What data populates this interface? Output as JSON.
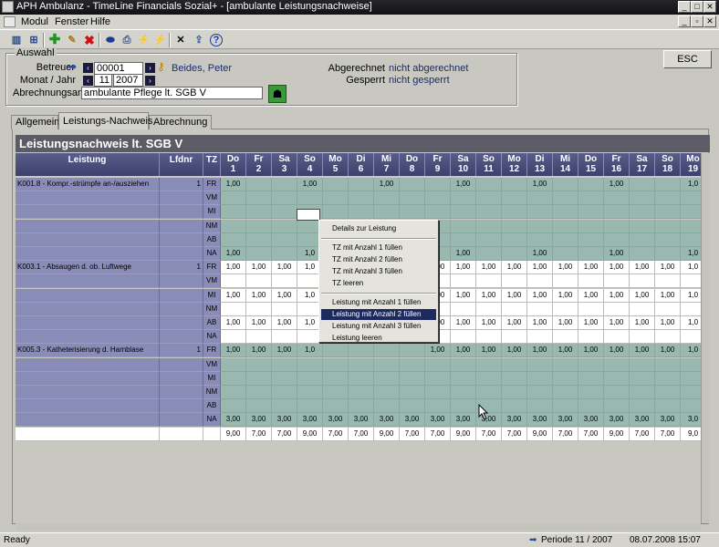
{
  "window": {
    "title": "APH Ambulanz - TimeLine Financials Sozial+ - [ambulante Leistungsnachweise]"
  },
  "menu": [
    "Modul",
    "Fenster",
    "Hilfe"
  ],
  "toolbar": {
    "icons": [
      "layout-icon",
      "tree-icon",
      "add-icon",
      "edit-icon",
      "delete-icon",
      "database-icon",
      "print-icon",
      "lightning-icon",
      "lightning-alt-icon",
      "cancel-icon",
      "export-icon",
      "help-icon"
    ]
  },
  "auswahl": {
    "legend": "Auswahl",
    "betreuer_label": "Betreuer",
    "betreuer_id": "00001",
    "betreuer_name": "Beides, Peter",
    "monat_label": "Monat / Jahr",
    "monat": "11",
    "jahr": "2007",
    "abrechnungsart_label": "Abrechnungsart",
    "abrechnungsart": "ambulante Pflege lt. SGB V",
    "abgerechnet_label": "Abgerechnet",
    "abgerechnet_value": "nicht abgerechnet",
    "gesperrt_label": "Gesperrt",
    "gesperrt_value": "nicht gesperrt"
  },
  "esc_label": "ESC",
  "tabs": [
    "Allgemein",
    "Leistungs-Nachweis",
    "Abrechnung"
  ],
  "panel_title": "Leistungsnachweis lt. SGB V",
  "grid": {
    "col_leistung": "Leistung",
    "col_lfdnr": "Lfdnr",
    "col_tz": "TZ",
    "days": [
      {
        "dow": "Do",
        "d": "1"
      },
      {
        "dow": "Fr",
        "d": "2"
      },
      {
        "dow": "Sa",
        "d": "3"
      },
      {
        "dow": "So",
        "d": "4"
      },
      {
        "dow": "Mo",
        "d": "5"
      },
      {
        "dow": "Di",
        "d": "6"
      },
      {
        "dow": "Mi",
        "d": "7"
      },
      {
        "dow": "Do",
        "d": "8"
      },
      {
        "dow": "Fr",
        "d": "9"
      },
      {
        "dow": "Sa",
        "d": "10"
      },
      {
        "dow": "So",
        "d": "11"
      },
      {
        "dow": "Mo",
        "d": "12"
      },
      {
        "dow": "Di",
        "d": "13"
      },
      {
        "dow": "Mi",
        "d": "14"
      },
      {
        "dow": "Do",
        "d": "15"
      },
      {
        "dow": "Fr",
        "d": "16"
      },
      {
        "dow": "Sa",
        "d": "17"
      },
      {
        "dow": "So",
        "d": "18"
      },
      {
        "dow": "Mo",
        "d": "19"
      }
    ],
    "rows": [
      {
        "leistung": "K001.8 - Kompr.-strümpfe an-/ausziehen",
        "lfdnr": "1",
        "tz": "FR",
        "style": "teal",
        "values": [
          "1,00",
          "",
          "",
          "1,00",
          "",
          "",
          "1,00",
          "",
          "",
          "1,00",
          "",
          "",
          "1,00",
          "",
          "",
          "1,00",
          "",
          "",
          "1,0"
        ]
      },
      {
        "leistung": "",
        "lfdnr": "",
        "tz": "VM",
        "style": "teal",
        "values": [
          "",
          "",
          "",
          "",
          "",
          "",
          "",
          "",
          "",
          "",
          "",
          "",
          "",
          "",
          "",
          "",
          "",
          "",
          ""
        ]
      },
      {
        "leistung": "",
        "lfdnr": "",
        "tz": "MI",
        "style": "teal",
        "values": [
          "",
          "",
          "",
          "",
          "",
          "",
          "",
          "",
          "",
          "",
          "",
          "",
          "",
          "",
          "",
          "",
          "",
          "",
          ""
        ]
      },
      {
        "leistung": "",
        "lfdnr": "",
        "tz": "NM",
        "style": "teal",
        "values": [
          "",
          "",
          "",
          "",
          "",
          "",
          "",
          "",
          "",
          "",
          "",
          "",
          "",
          "",
          "",
          "",
          "",
          "",
          ""
        ]
      },
      {
        "leistung": "",
        "lfdnr": "",
        "tz": "AB",
        "style": "teal",
        "values": [
          "",
          "",
          "",
          "",
          "",
          "",
          "",
          "",
          "",
          "",
          "",
          "",
          "",
          "",
          "",
          "",
          "",
          "",
          ""
        ]
      },
      {
        "leistung": "",
        "lfdnr": "",
        "tz": "NA",
        "style": "teal",
        "values": [
          "1,00",
          "",
          "",
          "1,0",
          "",
          "",
          "",
          "",
          "",
          "1,00",
          "",
          "",
          "1,00",
          "",
          "",
          "1,00",
          "",
          "",
          "1,0"
        ]
      },
      {
        "leistung": "K003.1 - Absaugen d. ob. Luftwege",
        "lfdnr": "1",
        "tz": "FR",
        "style": "white",
        "values": [
          "1,00",
          "1,00",
          "1,00",
          "1,0",
          "",
          "",
          "",
          "",
          "1,00",
          "1,00",
          "1,00",
          "1,00",
          "1,00",
          "1,00",
          "1,00",
          "1,00",
          "1,00",
          "1,00",
          "1,0"
        ]
      },
      {
        "leistung": "",
        "lfdnr": "",
        "tz": "VM",
        "style": "white",
        "values": [
          "",
          "",
          "",
          "",
          "",
          "",
          "",
          "",
          "",
          "",
          "",
          "",
          "",
          "",
          "",
          "",
          "",
          "",
          ""
        ]
      },
      {
        "leistung": "",
        "lfdnr": "",
        "tz": "MI",
        "style": "white",
        "values": [
          "1,00",
          "1,00",
          "1,00",
          "1,0",
          "",
          "",
          "",
          "",
          "1,00",
          "1,00",
          "1,00",
          "1,00",
          "1,00",
          "1,00",
          "1,00",
          "1,00",
          "1,00",
          "1,00",
          "1,0"
        ]
      },
      {
        "leistung": "",
        "lfdnr": "",
        "tz": "NM",
        "style": "white",
        "values": [
          "",
          "",
          "",
          "",
          "",
          "",
          "",
          "",
          "",
          "",
          "",
          "",
          "",
          "",
          "",
          "",
          "",
          "",
          ""
        ]
      },
      {
        "leistung": "",
        "lfdnr": "",
        "tz": "AB",
        "style": "white",
        "values": [
          "1,00",
          "1,00",
          "1,00",
          "1,0",
          "",
          "",
          "",
          "",
          "1,00",
          "1,00",
          "1,00",
          "1,00",
          "1,00",
          "1,00",
          "1,00",
          "1,00",
          "1,00",
          "1,00",
          "1,0"
        ]
      },
      {
        "leistung": "",
        "lfdnr": "",
        "tz": "NA",
        "style": "white",
        "values": [
          "",
          "",
          "",
          "",
          "",
          "",
          "",
          "",
          "",
          "",
          "",
          "",
          "",
          "",
          "",
          "",
          "",
          "",
          ""
        ]
      },
      {
        "leistung": "K005.3 - Katheterisierung d. Harnblase",
        "lfdnr": "1",
        "tz": "FR",
        "style": "teal",
        "values": [
          "1,00",
          "1,00",
          "1,00",
          "1,0",
          "",
          "",
          "",
          "",
          "1,00",
          "1,00",
          "1,00",
          "1,00",
          "1,00",
          "1,00",
          "1,00",
          "1,00",
          "1,00",
          "1,00",
          "1,0"
        ]
      },
      {
        "leistung": "",
        "lfdnr": "",
        "tz": "VM",
        "style": "teal",
        "values": [
          "",
          "",
          "",
          "",
          "",
          "",
          "",
          "",
          "",
          "",
          "",
          "",
          "",
          "",
          "",
          "",
          "",
          "",
          ""
        ]
      },
      {
        "leistung": "",
        "lfdnr": "",
        "tz": "MI",
        "style": "teal",
        "values": [
          "",
          "",
          "",
          "",
          "",
          "",
          "",
          "",
          "",
          "",
          "",
          "",
          "",
          "",
          "",
          "",
          "",
          "",
          ""
        ]
      },
      {
        "leistung": "",
        "lfdnr": "",
        "tz": "NM",
        "style": "teal",
        "values": [
          "",
          "",
          "",
          "",
          "",
          "",
          "",
          "",
          "",
          "",
          "",
          "",
          "",
          "",
          "",
          "",
          "",
          "",
          ""
        ]
      },
      {
        "leistung": "",
        "lfdnr": "",
        "tz": "AB",
        "style": "teal",
        "values": [
          "",
          "",
          "",
          "",
          "",
          "",
          "",
          "",
          "",
          "",
          "",
          "",
          "",
          "",
          "",
          "",
          "",
          "",
          ""
        ]
      },
      {
        "leistung": "",
        "lfdnr": "",
        "tz": "NA",
        "style": "teal",
        "values": [
          "3,00",
          "3,00",
          "3,00",
          "3,00",
          "3,00",
          "3,00",
          "3,00",
          "3,00",
          "3,00",
          "3,00",
          "3,00",
          "3,00",
          "3,00",
          "3,00",
          "3,00",
          "3,00",
          "3,00",
          "3,00",
          "3,0"
        ]
      },
      {
        "leistung": "",
        "lfdnr": "",
        "tz": "",
        "style": "totals",
        "values": [
          "9,00",
          "7,00",
          "7,00",
          "9,00",
          "7,00",
          "7,00",
          "9,00",
          "7,00",
          "7,00",
          "9,00",
          "7,00",
          "7,00",
          "9,00",
          "7,00",
          "7,00",
          "9,00",
          "7,00",
          "7,00",
          "9,0"
        ]
      }
    ]
  },
  "context_menu": {
    "items": [
      {
        "label": "Details zur Leistung"
      },
      {
        "sep": true
      },
      {
        "label": "TZ mit Anzahl 1 füllen"
      },
      {
        "label": "TZ mit Anzahl 2 füllen"
      },
      {
        "label": "TZ mit Anzahl 3 füllen"
      },
      {
        "label": "TZ leeren"
      },
      {
        "sep": true
      },
      {
        "label": "Leistung mit Anzahl 1 füllen"
      },
      {
        "label": "Leistung mit Anzahl 2 füllen",
        "highlighted": true
      },
      {
        "label": "Leistung mit Anzahl 3 füllen"
      },
      {
        "label": "Leistung leeren"
      }
    ]
  },
  "status": {
    "left": "Ready",
    "periode": "Periode 11 / 2007",
    "datetime": "08.07.2008 15:07"
  }
}
